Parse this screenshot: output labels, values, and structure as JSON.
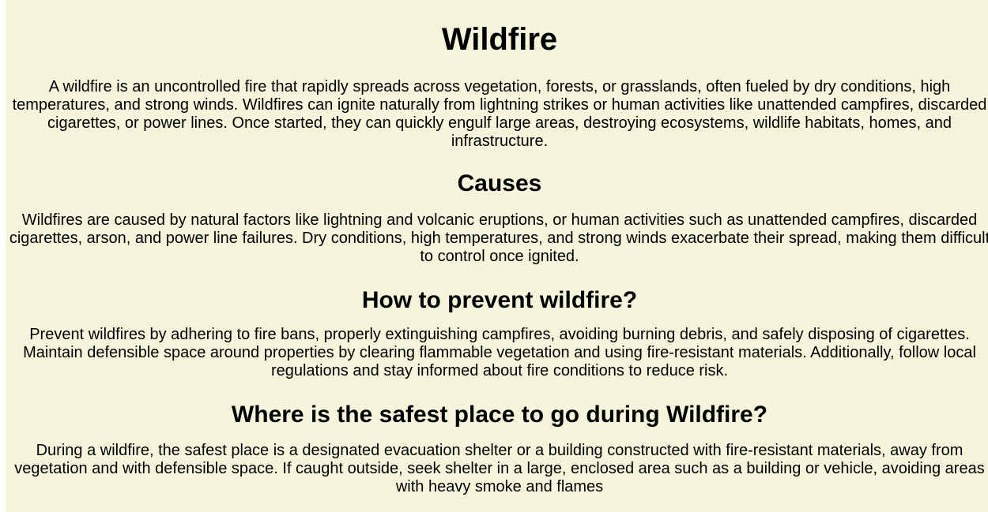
{
  "page": {
    "title": "Wildfire",
    "intro": "A wildfire is an uncontrolled fire that rapidly spreads across vegetation, forests, or grasslands, often fueled by dry conditions, high temperatures, and strong winds. Wildfires can ignite naturally from lightning strikes or human activities like unattended campfires, discarded cigarettes, or power lines. Once started, they can quickly engulf large areas, destroying ecosystems, wildlife habitats, homes, and infrastructure.",
    "sections": [
      {
        "heading": "Causes",
        "body": "Wildfires are caused by natural factors like lightning and volcanic eruptions, or human activities such as unattended campfires, discarded cigarettes, arson, and power line failures. Dry conditions, high temperatures, and strong winds exacerbate their spread, making them difficult to control once ignited."
      },
      {
        "heading": "How to prevent wildfire?",
        "body": "Prevent wildfires by adhering to fire bans, properly extinguishing campfires, avoiding burning debris, and safely disposing of cigarettes. Maintain defensible space around properties by clearing flammable vegetation and using fire-resistant materials. Additionally, follow local regulations and stay informed about fire conditions to reduce risk."
      },
      {
        "heading": "Where is the safest place to go during Wildfire?",
        "body": "During a wildfire, the safest place is a designated evacuation shelter or a building constructed with fire-resistant materials, away from vegetation and with defensible space. If caught outside, seek shelter in a large, enclosed area such as a building or vehicle, avoiding areas with heavy smoke and flames"
      }
    ]
  },
  "colors": {
    "background": "#f5f5dc",
    "text": "#000000"
  }
}
